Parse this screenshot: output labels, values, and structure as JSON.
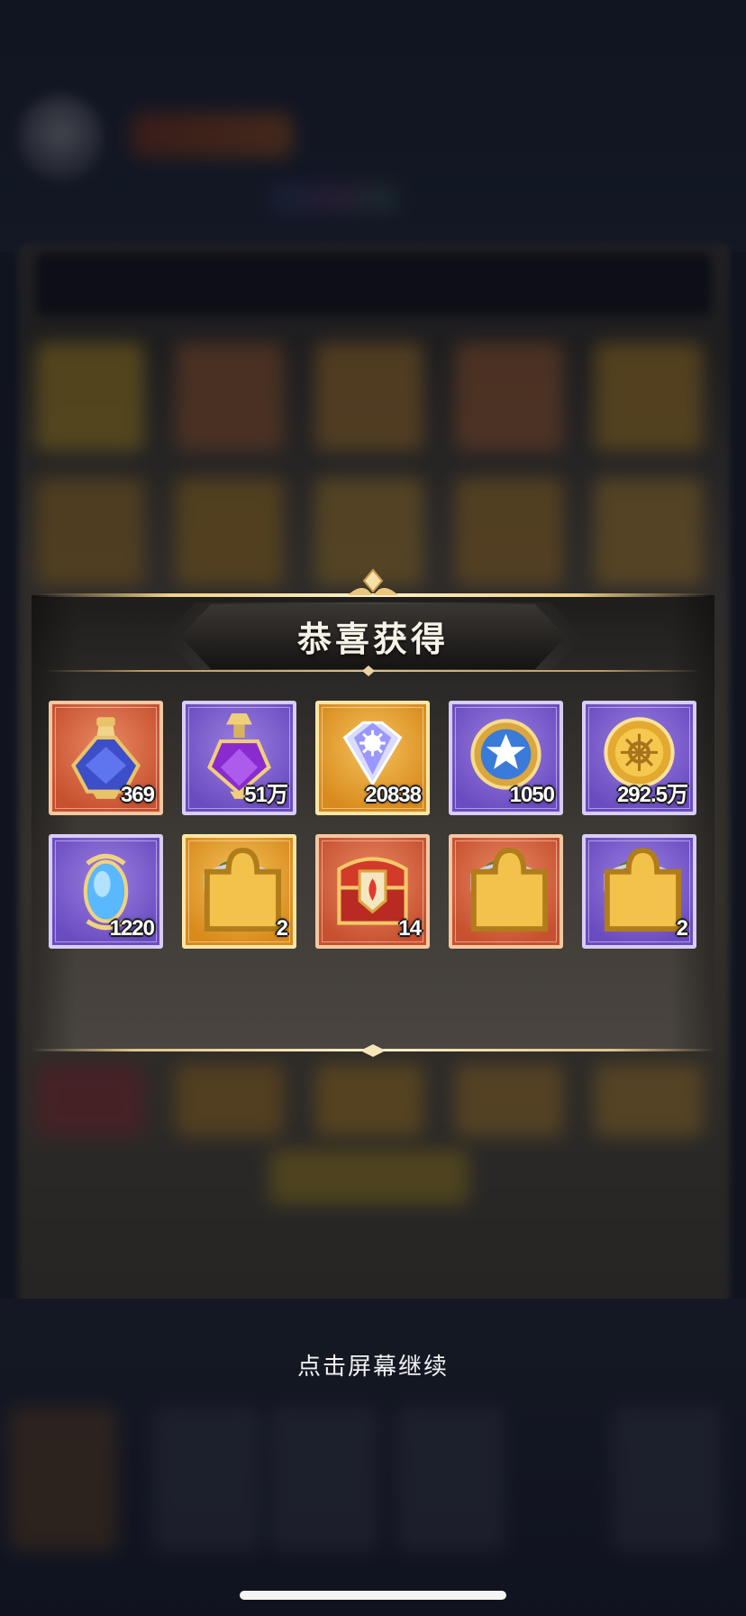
{
  "dialog": {
    "title": "恭喜获得",
    "items": [
      {
        "name": "blue-potion",
        "quantity": "369",
        "frame": "red"
      },
      {
        "name": "purple-potion",
        "quantity": "51万",
        "frame": "purple"
      },
      {
        "name": "diamond-gem",
        "quantity": "20838",
        "frame": "gold"
      },
      {
        "name": "star-coin",
        "quantity": "1050",
        "frame": "purple"
      },
      {
        "name": "gold-coin",
        "quantity": "292.5万",
        "frame": "purple"
      },
      {
        "name": "blue-crystal",
        "quantity": "1220",
        "frame": "purple"
      },
      {
        "name": "gold-chest",
        "quantity": "2",
        "frame": "gold"
      },
      {
        "name": "flame-chest",
        "quantity": "14",
        "frame": "red"
      },
      {
        "name": "red-chest",
        "quantity": "",
        "frame": "red"
      },
      {
        "name": "purple-chest",
        "quantity": "2",
        "frame": "purple"
      }
    ]
  },
  "hint": "点击屏幕继续",
  "colors": {
    "red_frame": "#c7502f",
    "purple_frame": "#6a4cc0",
    "gold_frame": "#d98a1c",
    "title_text": "#f7f2e8"
  }
}
